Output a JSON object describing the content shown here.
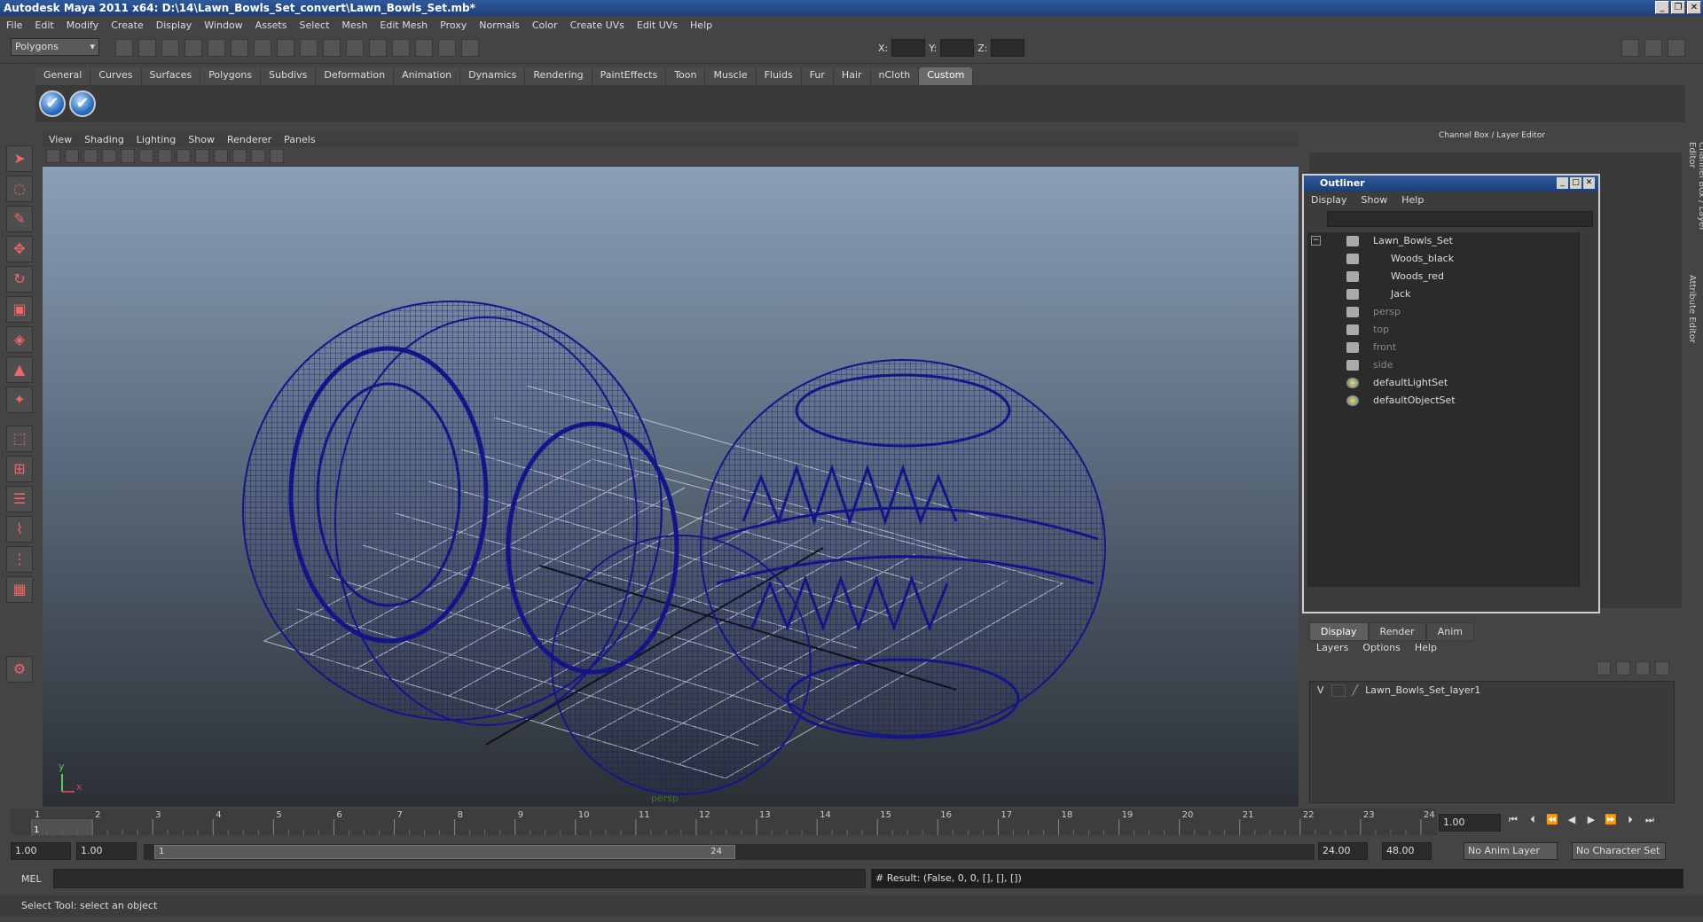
{
  "window": {
    "title": "Autodesk Maya 2011 x64: D:\\14\\Lawn_Bowls_Set_convert\\Lawn_Bowls_Set.mb*"
  },
  "menu": [
    "File",
    "Edit",
    "Modify",
    "Create",
    "Display",
    "Window",
    "Assets",
    "Select",
    "Mesh",
    "Edit Mesh",
    "Proxy",
    "Normals",
    "Color",
    "Create UVs",
    "Edit UVs",
    "Help"
  ],
  "status": {
    "mode": "Polygons",
    "x_label": "X:",
    "y_label": "Y:",
    "z_label": "Z:"
  },
  "shelf": {
    "tabs": [
      "General",
      "Curves",
      "Surfaces",
      "Polygons",
      "Subdivs",
      "Deformation",
      "Animation",
      "Dynamics",
      "Rendering",
      "PaintEffects",
      "Toon",
      "Muscle",
      "Fluids",
      "Fur",
      "Hair",
      "nCloth",
      "Custom"
    ],
    "active": "Custom",
    "icons": [
      "check-icon",
      "check-icon"
    ]
  },
  "viewport": {
    "menu": [
      "View",
      "Shading",
      "Lighting",
      "Show",
      "Renderer",
      "Panels"
    ],
    "camera": "persp",
    "axis_x": "x",
    "axis_y": "y",
    "wire_color": "#1a1a8a"
  },
  "channel_box": {
    "title": "Channel Box / Layer Editor",
    "side_tabs": [
      "Channel Box / Layer Editor",
      "Attribute Editor"
    ]
  },
  "outliner": {
    "title": "Outliner",
    "menu": [
      "Display",
      "Show",
      "Help"
    ],
    "items": [
      {
        "label": "Lawn_Bowls_Set",
        "level": 0,
        "dim": false,
        "icon": "group-icon"
      },
      {
        "label": "Woods_black",
        "level": 1,
        "dim": false,
        "icon": "mesh-icon"
      },
      {
        "label": "Woods_red",
        "level": 1,
        "dim": false,
        "icon": "mesh-icon"
      },
      {
        "label": "Jack",
        "level": 1,
        "dim": false,
        "icon": "mesh-icon"
      },
      {
        "label": "persp",
        "level": 0,
        "dim": true,
        "icon": "camera-icon"
      },
      {
        "label": "top",
        "level": 0,
        "dim": true,
        "icon": "camera-icon"
      },
      {
        "label": "front",
        "level": 0,
        "dim": true,
        "icon": "camera-icon"
      },
      {
        "label": "side",
        "level": 0,
        "dim": true,
        "icon": "camera-icon"
      },
      {
        "label": "defaultLightSet",
        "level": 0,
        "dim": false,
        "icon": "set-icon"
      },
      {
        "label": "defaultObjectSet",
        "level": 0,
        "dim": false,
        "icon": "set-icon"
      }
    ]
  },
  "layers": {
    "tabs": [
      "Display",
      "Render",
      "Anim"
    ],
    "active": "Display",
    "menu": [
      "Layers",
      "Options",
      "Help"
    ],
    "rows": [
      {
        "visible": "V",
        "name": "Lawn_Bowls_Set_layer1"
      }
    ]
  },
  "timeline": {
    "ticks": [
      "1",
      "2",
      "3",
      "4",
      "5",
      "6",
      "7",
      "8",
      "9",
      "10",
      "11",
      "12",
      "13",
      "14",
      "15",
      "16",
      "17",
      "18",
      "19",
      "20",
      "21",
      "22",
      "23",
      "24"
    ],
    "current_frame": "1",
    "current_field": "1.00"
  },
  "range": {
    "start": "1.00",
    "inner_start": "1.00",
    "slider_start": "1",
    "slider_end": "24",
    "end": "24.00",
    "outer_end": "48.00",
    "anim_layer": "No Anim Layer",
    "char_set": "No Character Set"
  },
  "cmd": {
    "lang": "MEL",
    "result": "# Result: (False, 0, 0, [], [], [])"
  },
  "help": "Select Tool: select an object"
}
